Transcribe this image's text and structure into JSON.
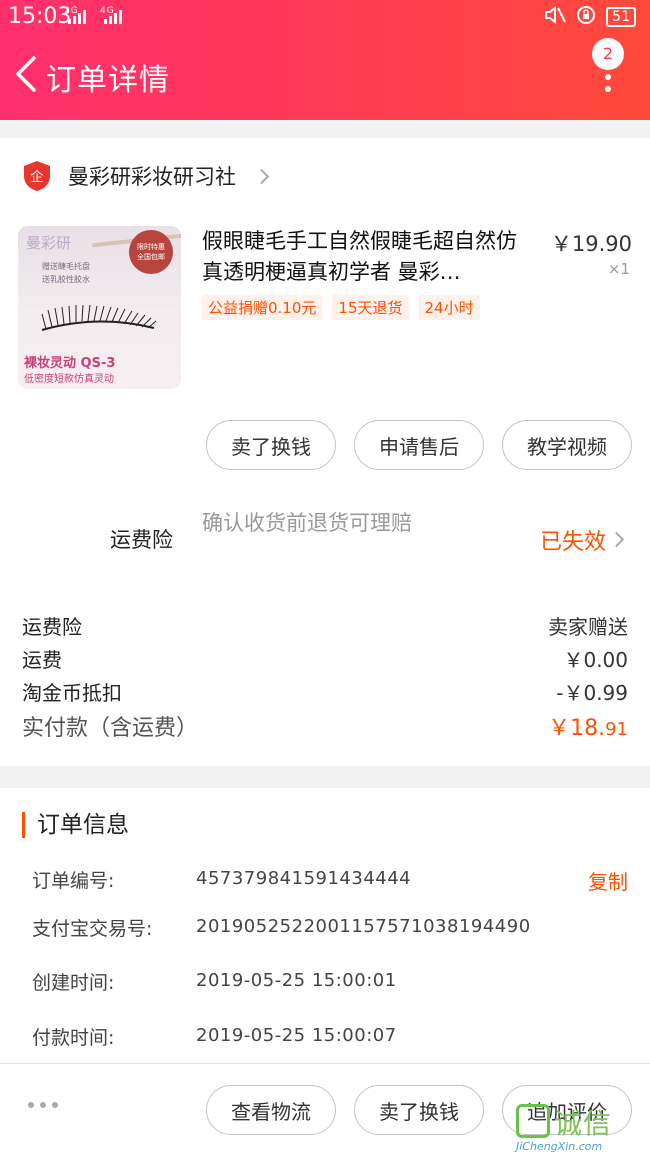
{
  "status_bar": {
    "time": "15:03",
    "net1": "2G",
    "net2": "4G",
    "battery": "51"
  },
  "header": {
    "title": "订单详情",
    "badge_count": "2"
  },
  "shop": {
    "name": "曼彩研彩妆研习社",
    "logo_text": "企"
  },
  "product": {
    "title": "假眼睫毛手工自然假睫毛超自然仿真透明梗逼真初学者 曼彩…",
    "price": "￥19.90",
    "quantity": "×1",
    "tags": [
      "公益捐赠0.10元",
      "15天退货",
      "24小时"
    ],
    "image": {
      "brand": "曼彩研",
      "seal": [
        "限时特惠",
        "全国包邮"
      ],
      "sub_lines": [
        "赠送睫毛托盘",
        "送乳胶性胶水"
      ],
      "caption": "裸妆灵动 QS-3",
      "caption2": "低密度短款仿真灵动"
    }
  },
  "item_actions": [
    "卖了换钱",
    "申请售后",
    "教学视频"
  ],
  "insurance": {
    "label": "运费险",
    "desc": "确认收货前退货可理赔",
    "status": "已失效"
  },
  "fees": [
    {
      "label": "运费险",
      "value": "卖家赠送"
    },
    {
      "label": "运费",
      "value": "￥0.00"
    },
    {
      "label": "淘金币抵扣",
      "value": "-￥0.99"
    }
  ],
  "total": {
    "label": "实付款（含运费）",
    "value_main": "￥18.",
    "value_cents": "91"
  },
  "order_info": {
    "title": "订单信息",
    "rows": [
      {
        "label": "订单编号:",
        "value": "457379841591434444"
      },
      {
        "label": "支付宝交易号:",
        "value": "2019052522001157571038194490"
      },
      {
        "label": "创建时间:",
        "value": "2019-05-25 15:00:01"
      },
      {
        "label": "付款时间:",
        "value": "2019-05-25 15:00:07"
      }
    ],
    "copy_label": "复制"
  },
  "bottom_actions": [
    "查看物流",
    "卖了换钱",
    "追加评价"
  ],
  "watermark": {
    "text": "诚信",
    "url": "JiChengXin.com"
  },
  "colors": {
    "accent": "#ff5000",
    "header_start": "#ff2f6d",
    "header_end": "#ff4a3a"
  }
}
